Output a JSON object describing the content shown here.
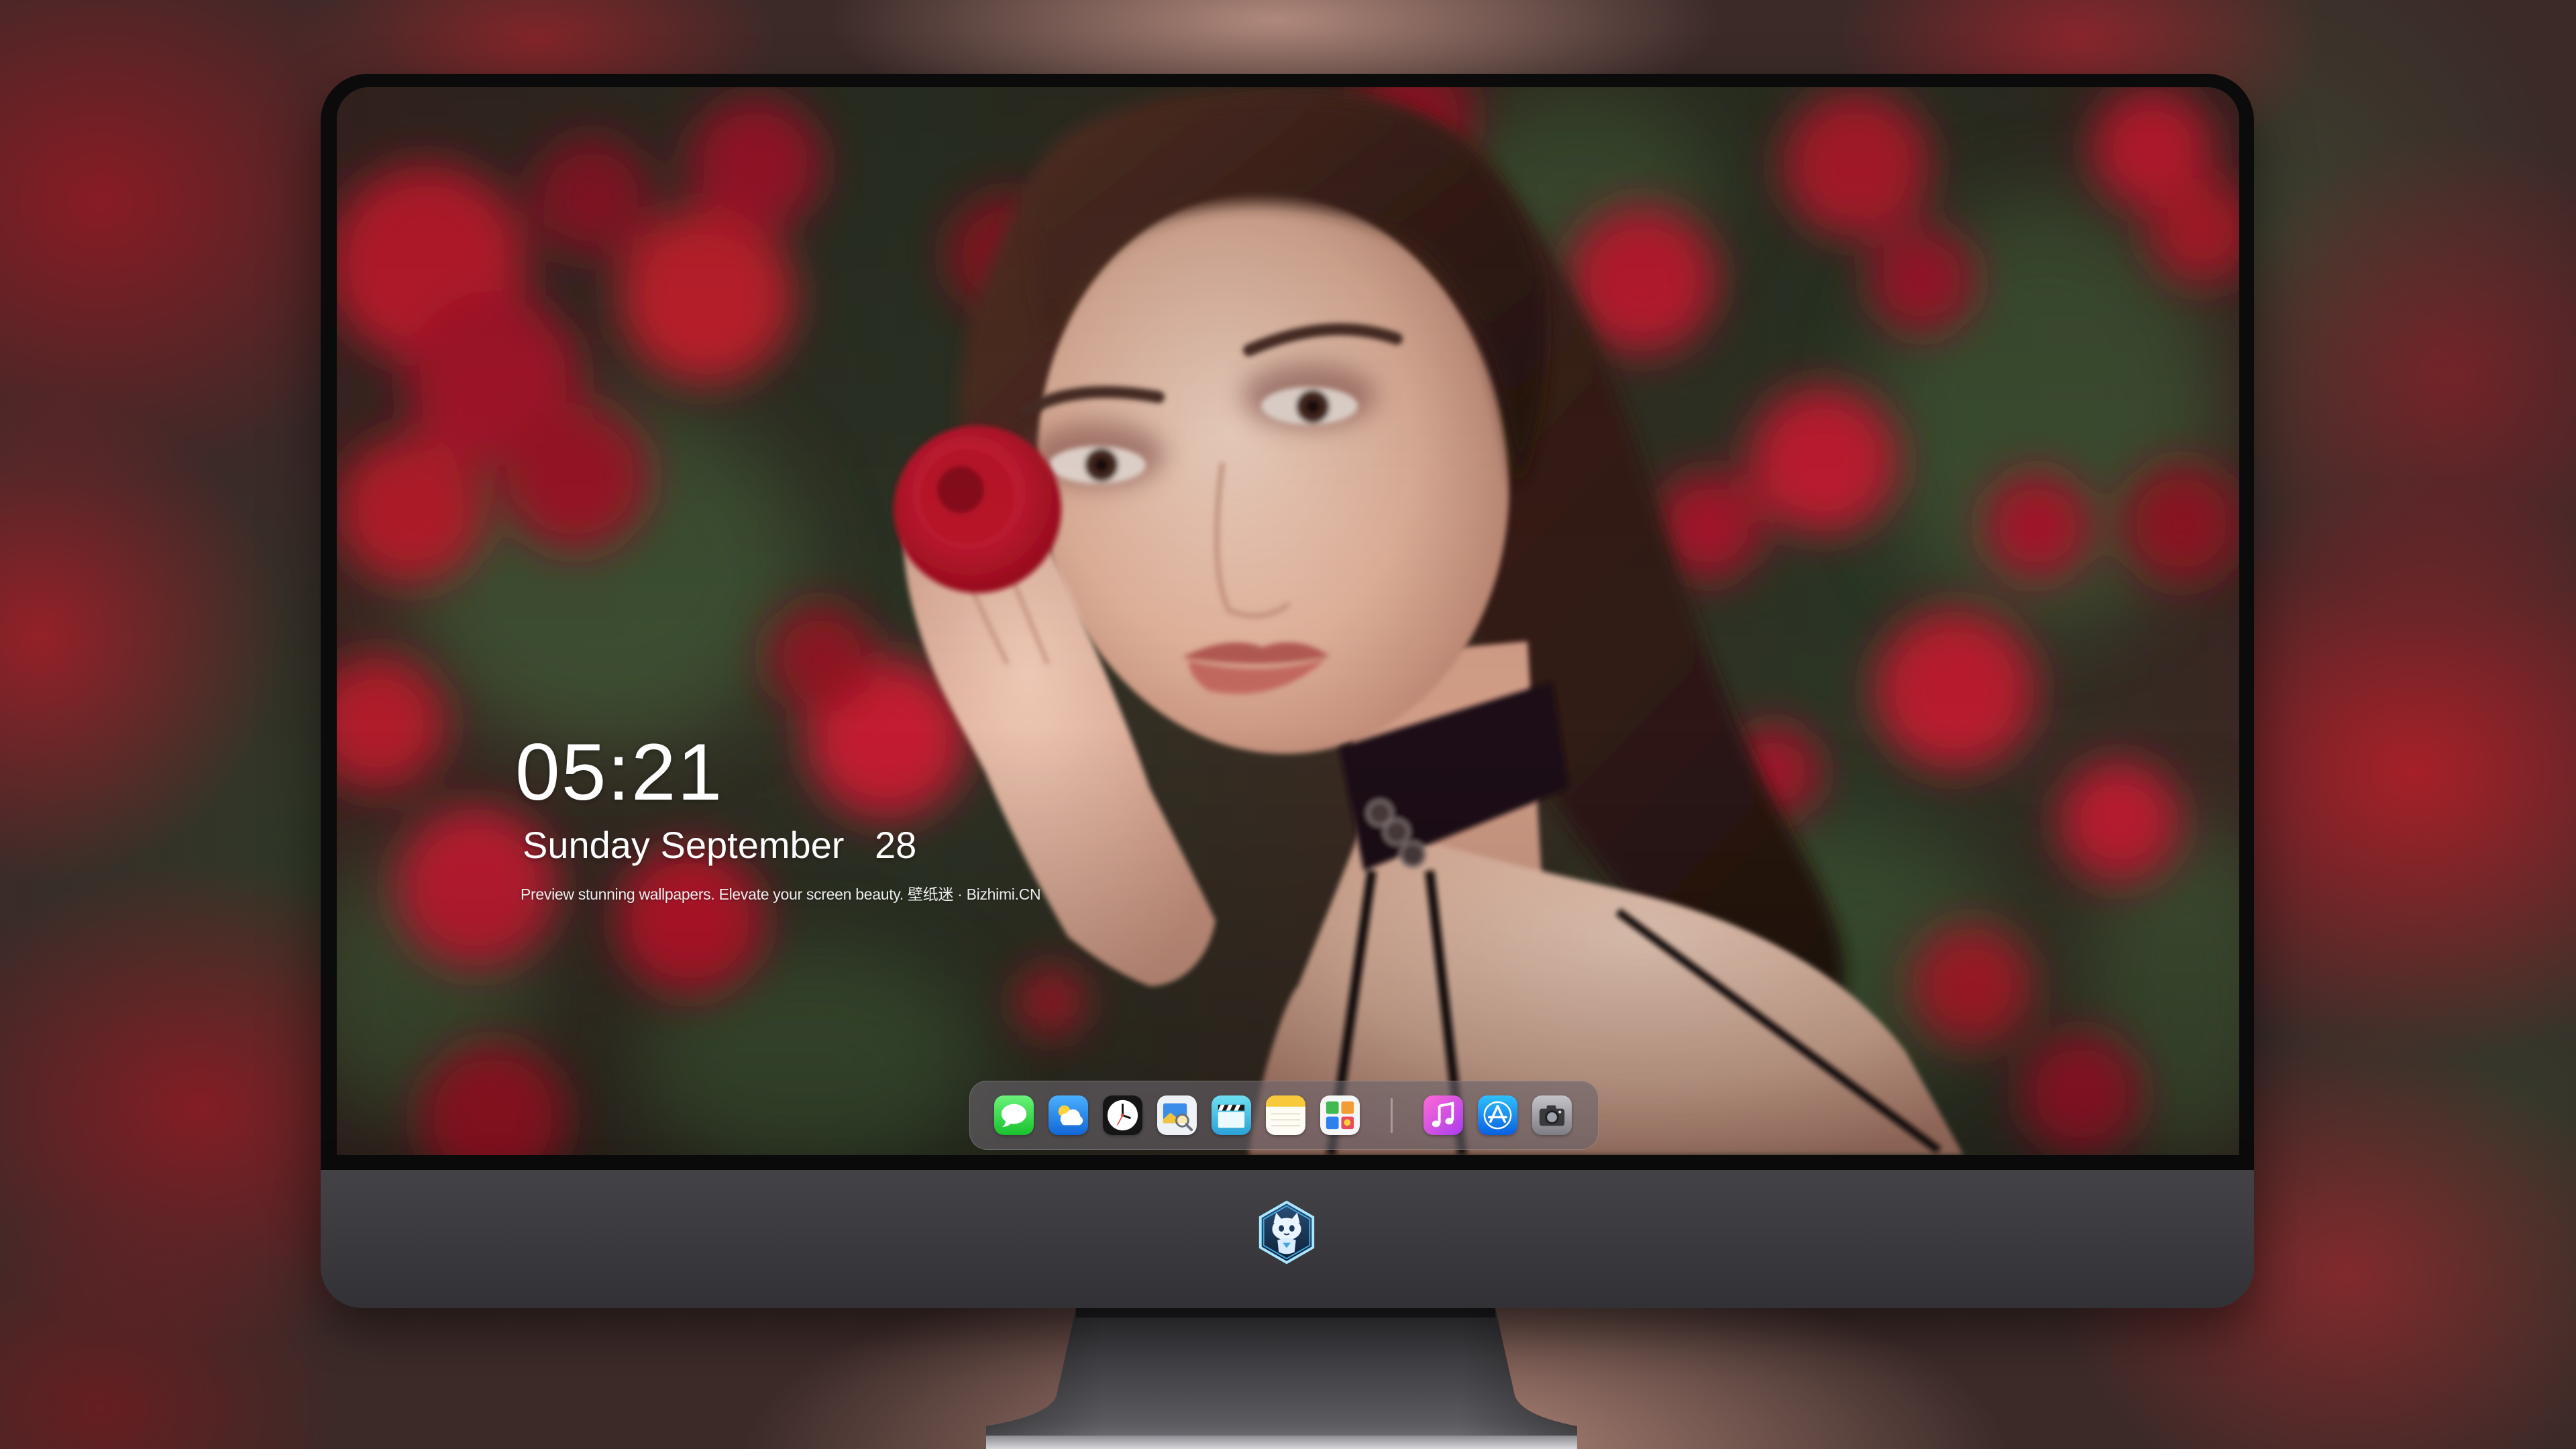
{
  "lock_screen": {
    "time": "05:21",
    "weekday": "Sunday",
    "month": "September",
    "day": "28",
    "tagline": "Preview stunning wallpapers. Elevate your screen beauty. 壁纸迷 · Bizhimi.CN"
  },
  "dock": {
    "pinned_apps": [
      {
        "icon": "messages-icon"
      },
      {
        "icon": "weather-icon"
      },
      {
        "icon": "clock-icon"
      },
      {
        "icon": "preview-icon"
      },
      {
        "icon": "video-clapper-icon"
      },
      {
        "icon": "notes-icon"
      },
      {
        "icon": "photo-gallery-icon"
      }
    ],
    "recent_apps": [
      {
        "icon": "music-icon"
      },
      {
        "icon": "app-store-icon"
      },
      {
        "icon": "camera-icon"
      }
    ]
  },
  "monitor": {
    "chin_logo_icon": "mascot-logo-icon"
  },
  "colors": {
    "monitor_frame": "#0b0b0c",
    "monitor_chin": "#3c3b3f",
    "lock_text": "#ffffff",
    "dock_background": "#69626a"
  }
}
